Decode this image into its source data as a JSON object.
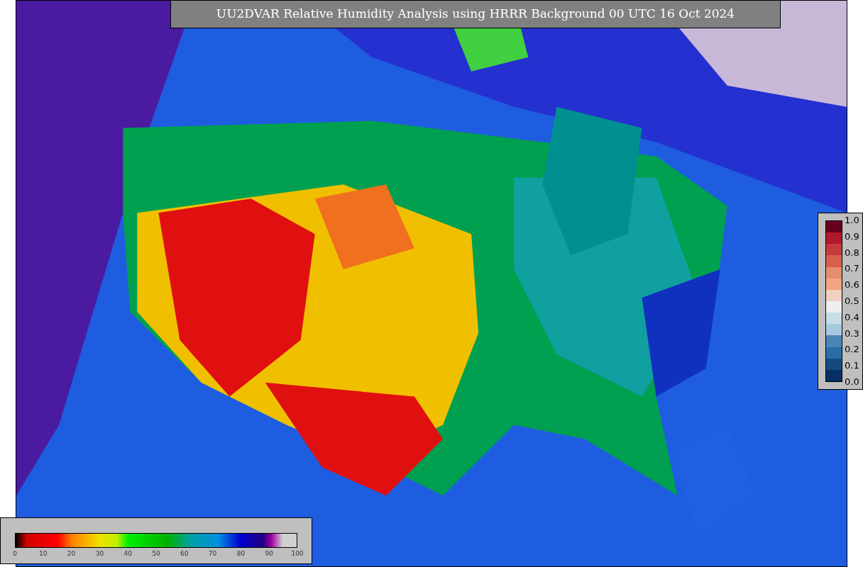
{
  "title": "UU2DVAR Relative Humidity Analysis using HRRR Background 00 UTC 16 Oct 2024",
  "station_colorbar": {
    "ticks": [
      "1.0",
      "0.9",
      "0.8",
      "0.7",
      "0.6",
      "0.5",
      "0.4",
      "0.3",
      "0.2",
      "0.1",
      "0.0"
    ]
  },
  "humidity_colorbar": {
    "ticks": [
      "0",
      "10",
      "20",
      "30",
      "40",
      "50",
      "60",
      "70",
      "80",
      "90",
      "100"
    ]
  }
}
